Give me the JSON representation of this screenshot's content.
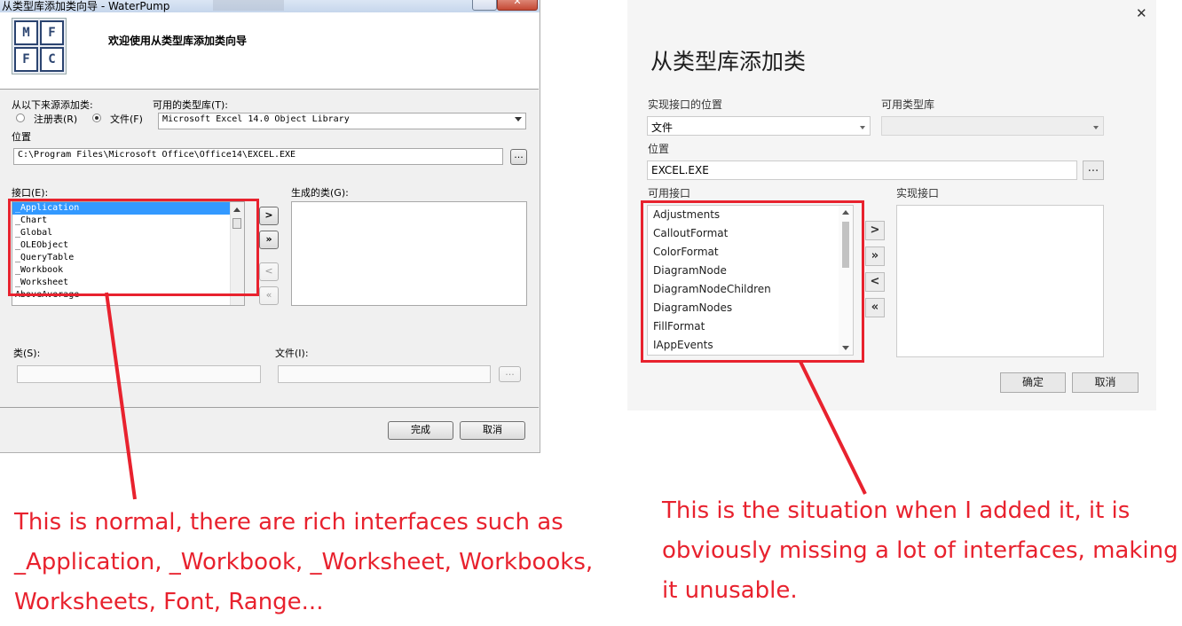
{
  "left_dialog": {
    "title": "从类型库添加类向导 - WaterPump",
    "minimize": "─",
    "close": "✕",
    "logo_letters": [
      "M",
      "F",
      "F",
      "C"
    ],
    "header_text": "欢迎使用从类型库添加类向导",
    "source_label": "从以下来源添加类:",
    "radio_registry": "注册表(R)",
    "radio_file": "文件(F)",
    "available_lib_label": "可用的类型库(T):",
    "available_lib_value": "Microsoft Excel 14.0 Object Library",
    "location_label": "位置",
    "location_value": "C:\\Program Files\\Microsoft Office\\Office14\\EXCEL.EXE",
    "browse_label": "...",
    "interfaces_label": "接口(E):",
    "interfaces": [
      "_Application",
      "_Chart",
      "_Global",
      "_OLEObject",
      "_QueryTable",
      "_Workbook",
      "_Worksheet",
      "AboveAverage"
    ],
    "generated_label": "生成的类(G):",
    "move_buttons": [
      ">",
      "»",
      "<",
      "«"
    ],
    "class_label": "类(S):",
    "file_label": "文件(I):",
    "file_browse": "...",
    "finish_button": "完成",
    "cancel_button": "取消"
  },
  "right_dialog": {
    "title": "从类型库添加类",
    "close": "✕",
    "impl_location_label": "实现接口的位置",
    "impl_location_value": "文件",
    "available_libs_label": "可用类型库",
    "location_label": "位置",
    "location_value": "EXCEL.EXE",
    "browse_label": "...",
    "available_interfaces_label": "可用接口",
    "interfaces": [
      "Adjustments",
      "CalloutFormat",
      "ColorFormat",
      "DiagramNode",
      "DiagramNodeChildren",
      "DiagramNodes",
      "FillFormat",
      "IAppEvents"
    ],
    "implemented_label": "实现接口",
    "move_buttons": [
      ">",
      "»",
      "<",
      "«"
    ],
    "ok_button": "确定",
    "cancel_button": "取消"
  },
  "captions": {
    "left": [
      "This is normal, there are rich interfaces such as",
      "_Application, _Workbook, _Worksheet, Workbooks,",
      "Worksheets, Font, Range..."
    ],
    "right": [
      "This is the situation when I added it, it is",
      "obviously missing a lot of interfaces, making",
      "it unusable."
    ]
  },
  "colors": {
    "annotation": "#e8222e",
    "selection": "#3399ff"
  }
}
